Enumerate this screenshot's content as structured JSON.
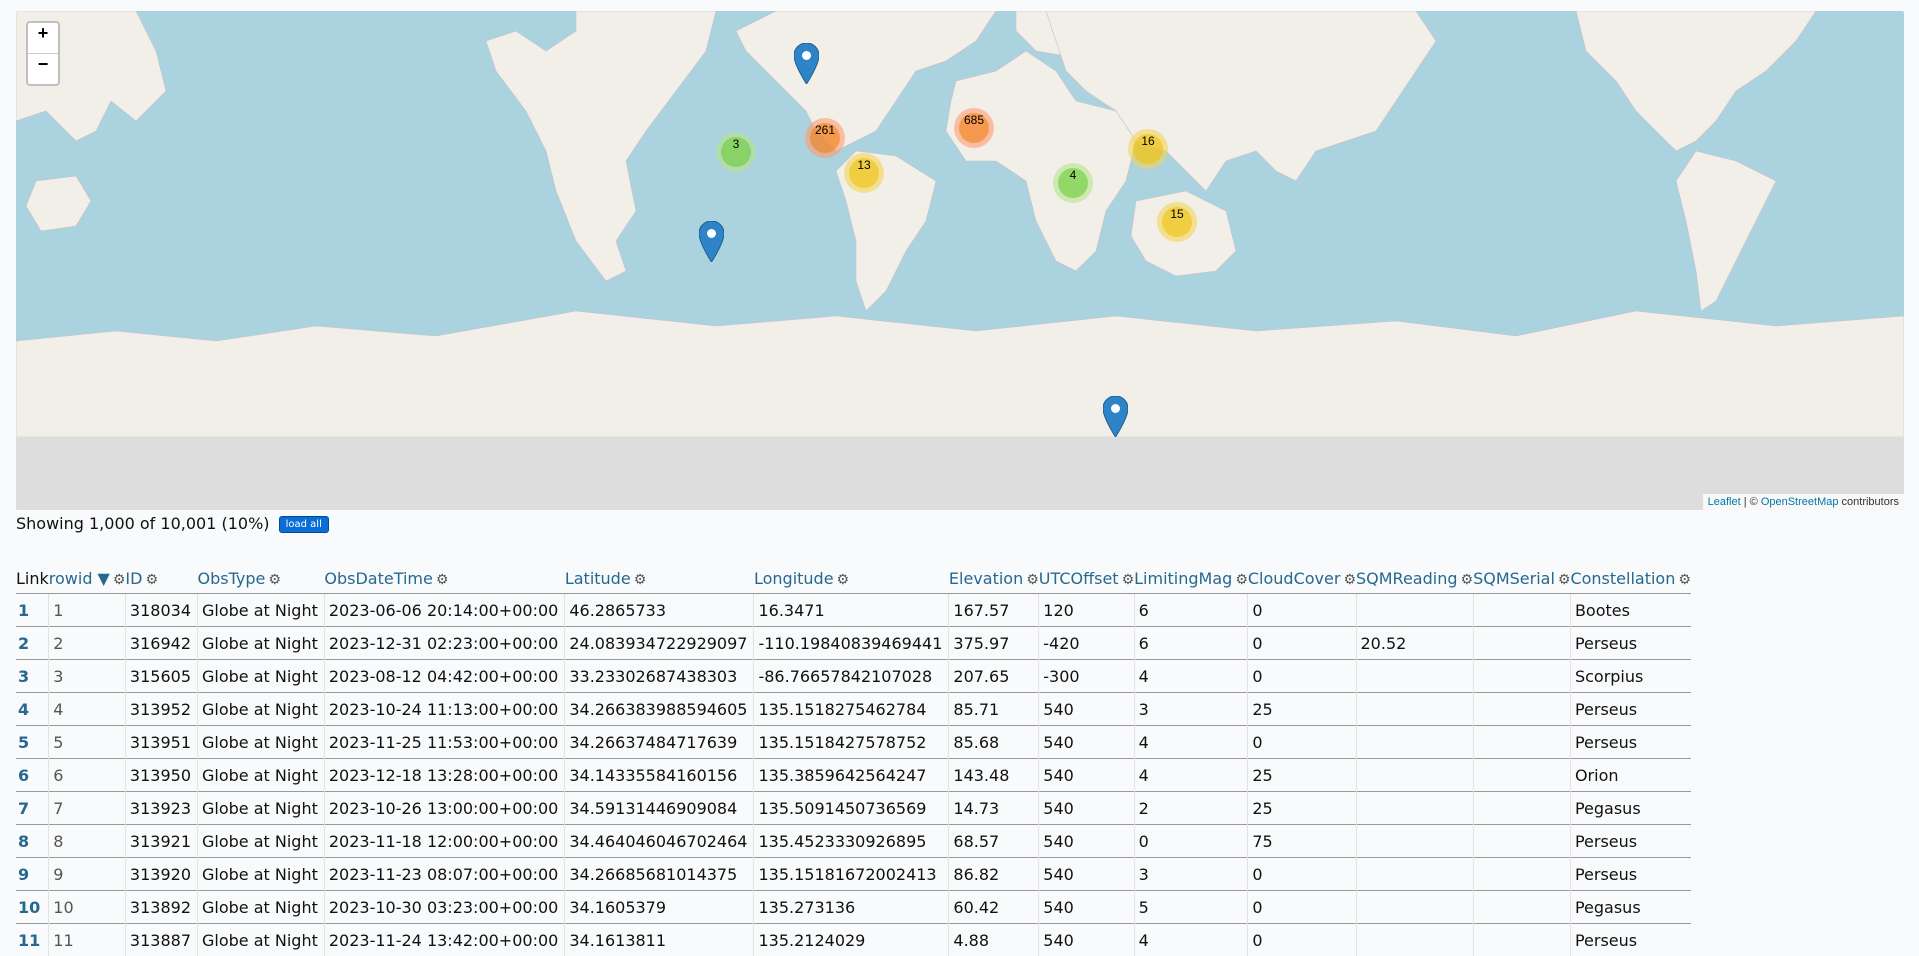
{
  "map": {
    "zoom_in": "+",
    "zoom_out": "−",
    "clusters": [
      {
        "count": "3",
        "color": "green"
      },
      {
        "count": "261",
        "color": "orange"
      },
      {
        "count": "13",
        "color": "yellow"
      },
      {
        "count": "685",
        "color": "orange"
      },
      {
        "count": "4",
        "color": "green"
      },
      {
        "count": "16",
        "color": "yellow"
      },
      {
        "count": "15",
        "color": "yellow"
      }
    ],
    "markers": [
      "map-marker-icon",
      "map-marker-icon",
      "map-marker-icon"
    ],
    "attribution": {
      "leaflet": "Leaflet",
      "separator": " | © ",
      "osm": "OpenStreetMap",
      "suffix": " contributors"
    }
  },
  "status": {
    "text": "Showing 1,000 of 10,001 (10%)",
    "load_all": "load all"
  },
  "table": {
    "columns": [
      "Link",
      "rowid ▼",
      "ID",
      "ObsType",
      "ObsDateTime",
      "Latitude",
      "Longitude",
      "Elevation",
      "UTCOffset",
      "LimitingMag",
      "CloudCover",
      "SQMReading",
      "SQMSerial",
      "Constellation"
    ],
    "rows": [
      [
        "1",
        "1",
        "318034",
        "Globe at Night",
        "2023-06-06 20:14:00+00:00",
        "46.2865733",
        "16.3471",
        "167.57",
        "120",
        "6",
        "0",
        "",
        "",
        "Bootes"
      ],
      [
        "2",
        "2",
        "316942",
        "Globe at Night",
        "2023-12-31 02:23:00+00:00",
        "24.083934722929097",
        "-110.19840839469441",
        "375.97",
        "-420",
        "6",
        "0",
        "20.52",
        "",
        "Perseus"
      ],
      [
        "3",
        "3",
        "315605",
        "Globe at Night",
        "2023-08-12 04:42:00+00:00",
        "33.23302687438303",
        "-86.76657842107028",
        "207.65",
        "-300",
        "4",
        "0",
        "",
        "",
        "Scorpius"
      ],
      [
        "4",
        "4",
        "313952",
        "Globe at Night",
        "2023-10-24 11:13:00+00:00",
        "34.266383988594605",
        "135.1518275462784",
        "85.71",
        "540",
        "3",
        "25",
        "",
        "",
        "Perseus"
      ],
      [
        "5",
        "5",
        "313951",
        "Globe at Night",
        "2023-11-25 11:53:00+00:00",
        "34.26637484717639",
        "135.1518427578752",
        "85.68",
        "540",
        "4",
        "0",
        "",
        "",
        "Perseus"
      ],
      [
        "6",
        "6",
        "313950",
        "Globe at Night",
        "2023-12-18 13:28:00+00:00",
        "34.14335584160156",
        "135.3859642564247",
        "143.48",
        "540",
        "4",
        "25",
        "",
        "",
        "Orion"
      ],
      [
        "7",
        "7",
        "313923",
        "Globe at Night",
        "2023-10-26 13:00:00+00:00",
        "34.59131446909084",
        "135.5091450736569",
        "14.73",
        "540",
        "2",
        "25",
        "",
        "",
        "Pegasus"
      ],
      [
        "8",
        "8",
        "313921",
        "Globe at Night",
        "2023-11-18 12:00:00+00:00",
        "34.464046046702464",
        "135.4523330926895",
        "68.57",
        "540",
        "0",
        "75",
        "",
        "",
        "Perseus"
      ],
      [
        "9",
        "9",
        "313920",
        "Globe at Night",
        "2023-11-23 08:07:00+00:00",
        "34.26685681014375",
        "135.15181672002413",
        "86.82",
        "540",
        "3",
        "0",
        "",
        "",
        "Perseus"
      ],
      [
        "10",
        "10",
        "313892",
        "Globe at Night",
        "2023-10-30 03:23:00+00:00",
        "34.1605379",
        "135.273136",
        "60.42",
        "540",
        "5",
        "0",
        "",
        "",
        "Pegasus"
      ],
      [
        "11",
        "11",
        "313887",
        "Globe at Night",
        "2023-11-24 13:42:00+00:00",
        "34.1613811",
        "135.2124029",
        "4.88",
        "540",
        "4",
        "0",
        "",
        "",
        "Perseus"
      ]
    ]
  }
}
